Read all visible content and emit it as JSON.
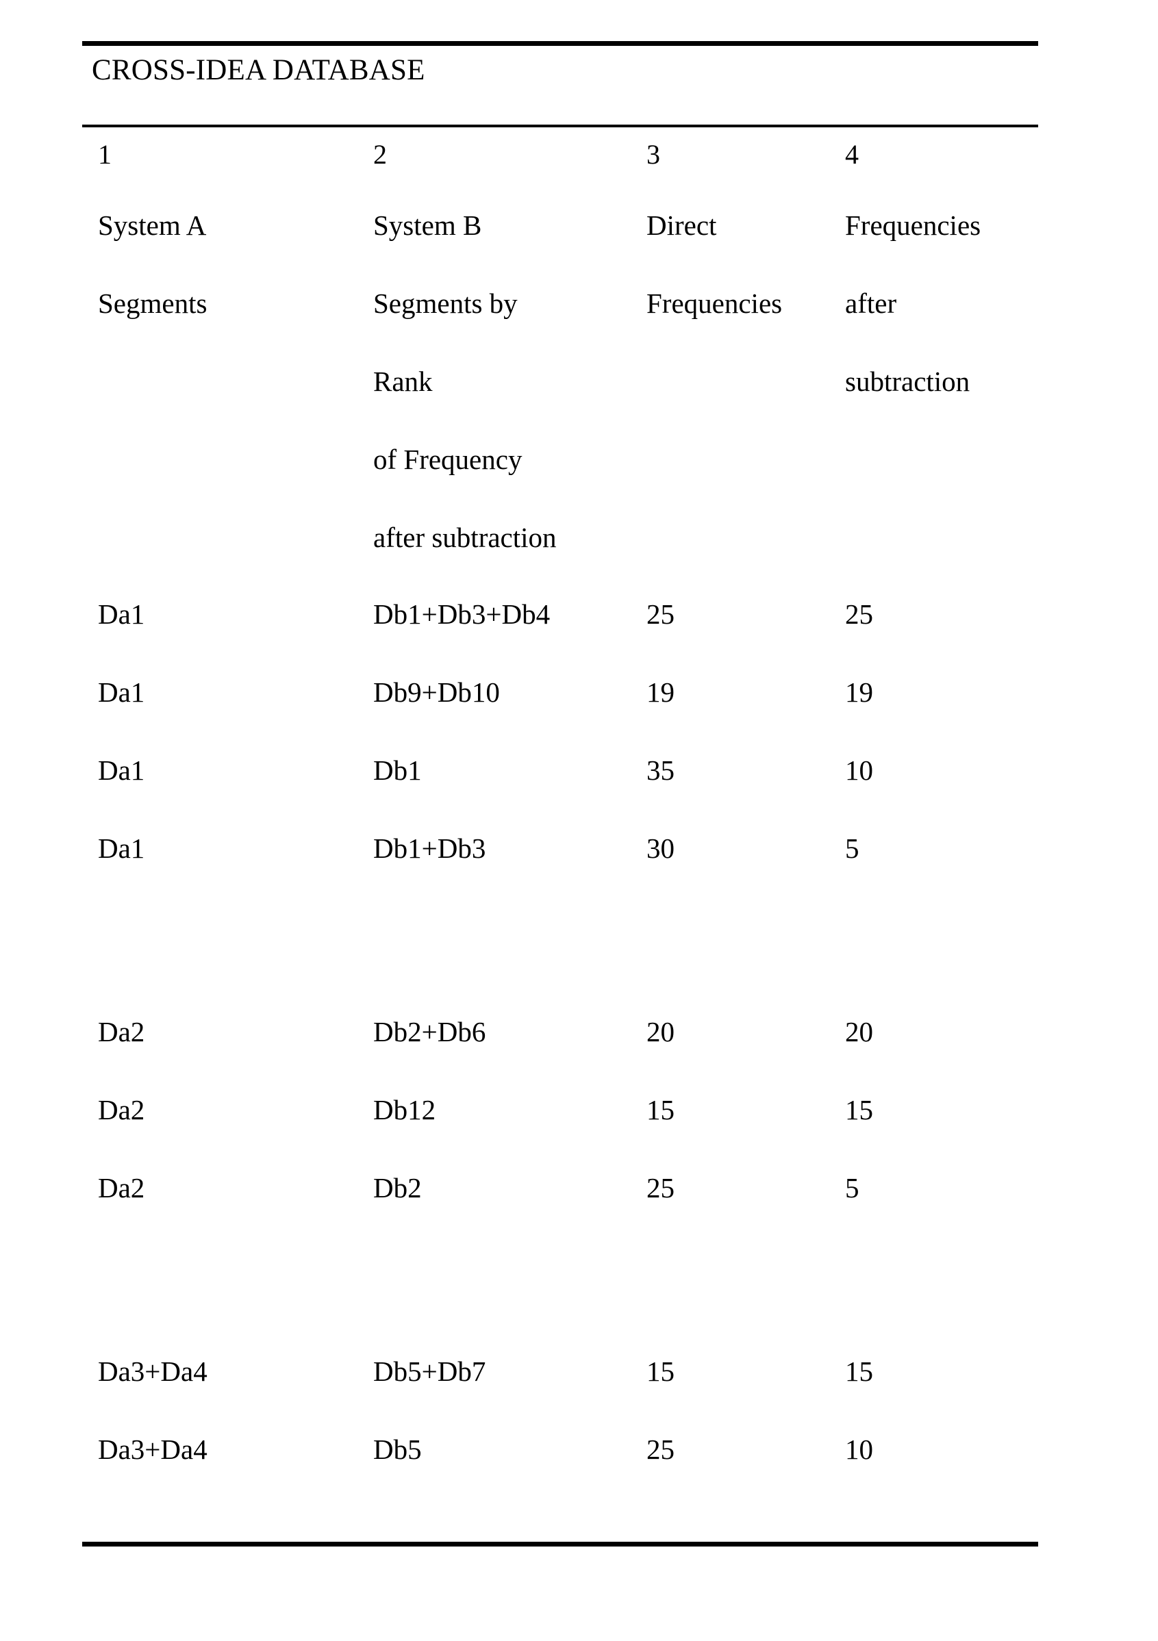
{
  "document": {
    "title": "CROSS-IDEA DATABASE"
  },
  "table": {
    "column_numbers": [
      "1",
      "2",
      "3",
      "4"
    ],
    "headers": {
      "col1": [
        "System A",
        "Segments"
      ],
      "col2": [
        "System B",
        "Segments by",
        "Rank",
        "of Frequency",
        "after subtraction"
      ],
      "col3": [
        "Direct",
        "Frequencies"
      ],
      "col4": [
        "Frequencies",
        "after",
        "subtraction"
      ]
    },
    "groups": [
      {
        "rows": [
          {
            "system_a": "Da1",
            "system_b": "Db1+Db3+Db4",
            "direct_frequency": "25",
            "frequency_after_subtraction": "25"
          },
          {
            "system_a": "Da1",
            "system_b": "Db9+Db10",
            "direct_frequency": "19",
            "frequency_after_subtraction": "19"
          },
          {
            "system_a": "Da1",
            "system_b": "Db1",
            "direct_frequency": "35",
            "frequency_after_subtraction": "10"
          },
          {
            "system_a": "Da1",
            "system_b": "Db1+Db3",
            "direct_frequency": "30",
            "frequency_after_subtraction": "5"
          }
        ]
      },
      {
        "rows": [
          {
            "system_a": "Da2",
            "system_b": "Db2+Db6",
            "direct_frequency": "20",
            "frequency_after_subtraction": "20"
          },
          {
            "system_a": "Da2",
            "system_b": "Db12",
            "direct_frequency": "15",
            "frequency_after_subtraction": "15"
          },
          {
            "system_a": "Da2",
            "system_b": "Db2",
            "direct_frequency": "25",
            "frequency_after_subtraction": "5"
          }
        ]
      },
      {
        "rows": [
          {
            "system_a": "Da3+Da4",
            "system_b": "Db5+Db7",
            "direct_frequency": "15",
            "frequency_after_subtraction": "15"
          },
          {
            "system_a": "Da3+Da4",
            "system_b": "Db5",
            "direct_frequency": "25",
            "frequency_after_subtraction": "10"
          }
        ]
      }
    ]
  }
}
